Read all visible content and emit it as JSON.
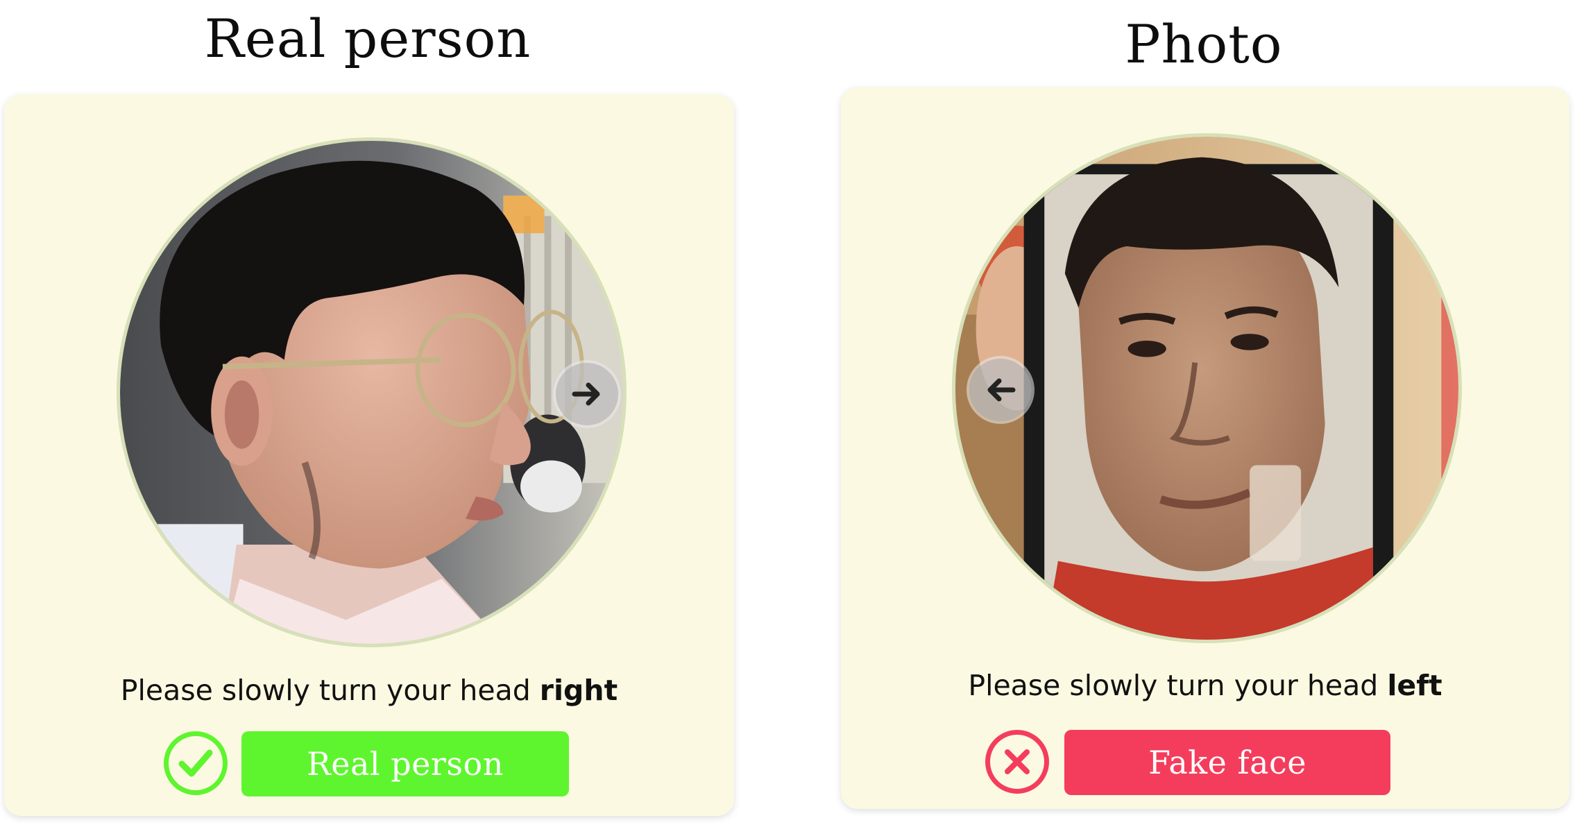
{
  "panels": [
    {
      "title": "Real person",
      "instruction_prefix": "Please slowly turn your head ",
      "instruction_direction": "right",
      "arrow_icon": "arrow-right-icon",
      "status_icon": "check-circle-icon",
      "result_label": "Real person",
      "result_color": "#5ef52e"
    },
    {
      "title": "Photo",
      "instruction_prefix": "Please slowly turn your head ",
      "instruction_direction": "left",
      "arrow_icon": "arrow-left-icon",
      "status_icon": "x-circle-icon",
      "result_label": "Fake face",
      "result_color": "#f43d5c"
    }
  ]
}
